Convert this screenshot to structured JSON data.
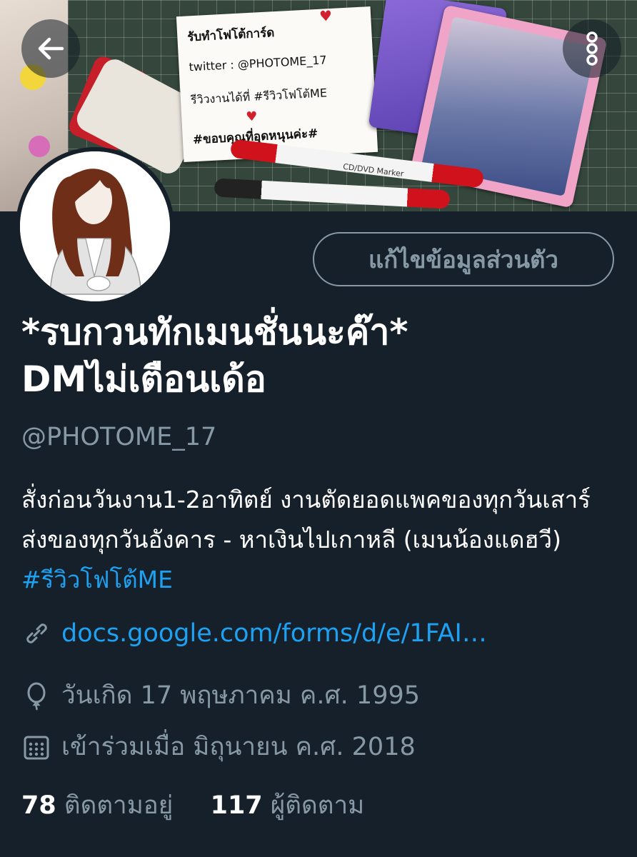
{
  "banner": {
    "note_lines": [
      "รับทำโฟโต้การ์ด",
      "twitter : @PHOTOME_17",
      "รีวิวงานได้ที่ #รีวิวโฟโต้ME",
      "#ขอบคุณที่อุดหนุนค่ะ#"
    ],
    "marker_label": "CD/DVD Marker"
  },
  "toolbar": {
    "back_icon": "arrow-left-icon",
    "more_icon": "vertical-dots-icon"
  },
  "profile": {
    "edit_button_label": "แก้ไขข้อมูลส่วนตัว",
    "name_line1": "*รบกวนทักเมนชั่นนะค๊า*",
    "name_line2": "DMไม่เตือนเด้อ",
    "handle": "@PHOTOME_17",
    "bio_text": "สั่งก่อนวันงาน1-2อาทิตย์ งานตัดยอดแพคของทุกวันเสาร์ ส่งของทุกวันอังคาร - หาเงินไปเกาหลี (เมนน้องแดฮวี) ",
    "bio_hashtag": "#รีวิวโฟโต้ME",
    "link": "docs.google.com/forms/d/e/1FAI…",
    "birthday": "วันเกิด 17 พฤษภาคม ค.ศ. 1995",
    "joined": "เข้าร่วมเมื่อ มิถุนายน ค.ศ. 2018",
    "following_count": "78",
    "following_label": "ติดตามอยู่",
    "followers_count": "117",
    "followers_label": "ผู้ติดตาม"
  },
  "colors": {
    "background": "#15202b",
    "accent": "#1da1f2",
    "secondary_text": "#8899a6"
  }
}
